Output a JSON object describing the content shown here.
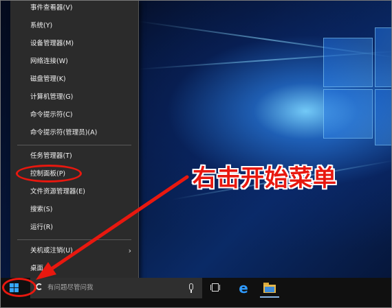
{
  "context_menu": {
    "items": [
      {
        "label": "事件查看器(V)"
      },
      {
        "label": "系统(Y)"
      },
      {
        "label": "设备管理器(M)"
      },
      {
        "label": "网络连接(W)"
      },
      {
        "label": "磁盘管理(K)"
      },
      {
        "label": "计算机管理(G)"
      },
      {
        "label": "命令提示符(C)"
      },
      {
        "label": "命令提示符(管理员)(A)"
      },
      {
        "label": "任务管理器(T)"
      },
      {
        "label": "控制面板(P)"
      },
      {
        "label": "文件资源管理器(E)"
      },
      {
        "label": "搜索(S)"
      },
      {
        "label": "运行(R)"
      },
      {
        "label": "关机或注销(U)"
      },
      {
        "label": "桌面"
      }
    ]
  },
  "taskbar": {
    "search_placeholder": "有问题尽管问我",
    "icons": [
      "windows-start-icon",
      "search-circle-icon",
      "microphone-icon",
      "task-view-icon",
      "edge-browser-icon",
      "file-explorer-icon"
    ]
  },
  "annotation": {
    "caption": "右击开始菜单",
    "color": "#e8180f"
  },
  "colors": {
    "menu_bg": "#2b2b2b",
    "taskbar_bg": "#101010",
    "accent_blue": "#35a7ff"
  }
}
